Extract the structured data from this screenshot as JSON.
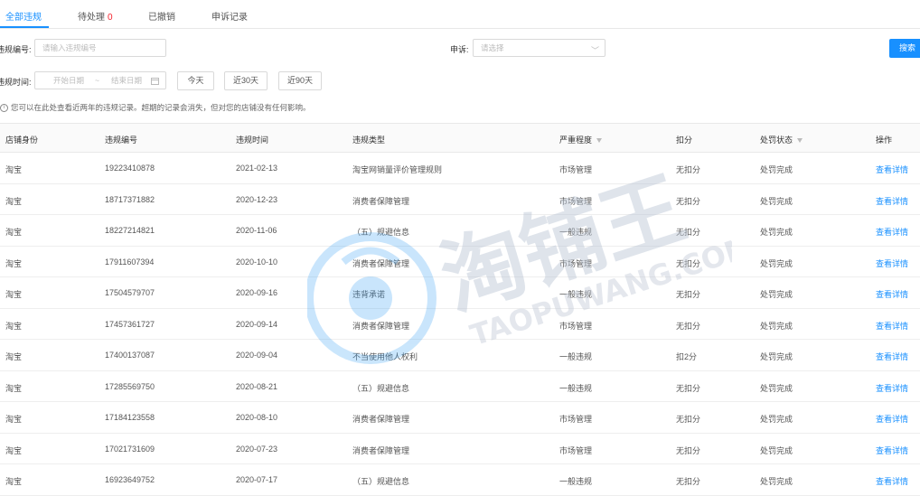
{
  "tabs": [
    {
      "label": "全部违规"
    },
    {
      "label": "待处理",
      "count": "0"
    },
    {
      "label": "已撤销"
    },
    {
      "label": "申诉记录"
    }
  ],
  "filters": {
    "violation_no_label": "违规编号:",
    "violation_no_placeholder": "请输入违规编号",
    "appeal_label": "申诉:",
    "appeal_placeholder": "请选择",
    "time_label": "违规时间:",
    "start_placeholder": "开始日期",
    "range_sep": "~",
    "end_placeholder": "结束日期",
    "today": "今天",
    "last30": "近30天",
    "last90": "近90天",
    "search": "搜索"
  },
  "notice": "您可以在此处查看近两年的违规记录。超期的记录会消失，但对您的店铺没有任何影响。",
  "table": {
    "headers": [
      "店铺身份",
      "违规编号",
      "违规时间",
      "违规类型",
      "严重程度",
      "扣分",
      "处罚状态",
      "操作"
    ],
    "rows": [
      [
        "淘宝",
        "19223410878",
        "2021-02-13",
        "淘宝网销量评价管理规则",
        "市场管理",
        "无扣分",
        "处罚完成",
        "查看详情"
      ],
      [
        "淘宝",
        "18717371882",
        "2020-12-23",
        "消费者保障管理",
        "市场管理",
        "无扣分",
        "处罚完成",
        "查看详情"
      ],
      [
        "淘宝",
        "18227214821",
        "2020-11-06",
        "（五）规避信息",
        "一般违规",
        "无扣分",
        "处罚完成",
        "查看详情"
      ],
      [
        "淘宝",
        "17911607394",
        "2020-10-10",
        "消费者保障管理",
        "市场管理",
        "无扣分",
        "处罚完成",
        "查看详情"
      ],
      [
        "淘宝",
        "17504579707",
        "2020-09-16",
        "违背承诺",
        "一般违规",
        "无扣分",
        "处罚完成",
        "查看详情"
      ],
      [
        "淘宝",
        "17457361727",
        "2020-09-14",
        "消费者保障管理",
        "市场管理",
        "无扣分",
        "处罚完成",
        "查看详情"
      ],
      [
        "淘宝",
        "17400137087",
        "2020-09-04",
        "不当使用他人权利",
        "一般违规",
        "扣2分",
        "处罚完成",
        "查看详情"
      ],
      [
        "淘宝",
        "17285569750",
        "2020-08-21",
        "（五）规避信息",
        "一般违规",
        "无扣分",
        "处罚完成",
        "查看详情"
      ],
      [
        "淘宝",
        "17184123558",
        "2020-08-10",
        "消费者保障管理",
        "市场管理",
        "无扣分",
        "处罚完成",
        "查看详情"
      ],
      [
        "淘宝",
        "17021731609",
        "2020-07-23",
        "消费者保障管理",
        "市场管理",
        "无扣分",
        "处罚完成",
        "查看详情"
      ],
      [
        "淘宝",
        "16923649752",
        "2020-07-17",
        "（五）规避信息",
        "一般违规",
        "无扣分",
        "处罚完成",
        "查看详情"
      ]
    ]
  },
  "watermark": {
    "text": "淘铺王",
    "sub": "TAOPUWANG.COM",
    "color": "#b9c4d4"
  },
  "icons": {
    "filter": "filter-icon",
    "calendar": "calendar-icon",
    "info": "info-icon",
    "chevron": "chevron-down-icon"
  },
  "colors": {
    "accent": "#1890ff",
    "badge": "#f5222d"
  }
}
